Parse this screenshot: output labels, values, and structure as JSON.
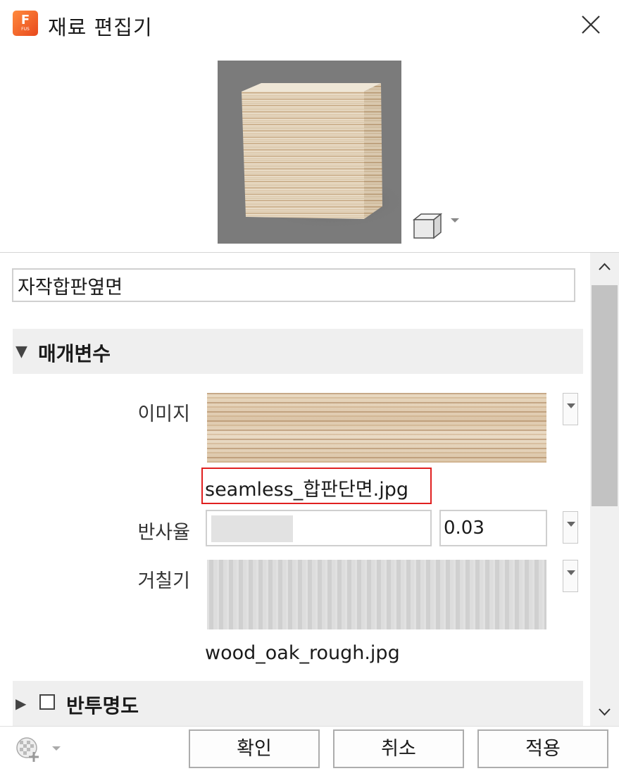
{
  "window": {
    "title": "재료 편집기",
    "app_icon_letter": "F",
    "app_icon_sub": "FUS"
  },
  "material": {
    "name": "자작합판옆면"
  },
  "sections": {
    "parameters": {
      "label": "매개변수"
    },
    "transparency": {
      "label": "반투명도",
      "checked": false
    }
  },
  "params": {
    "image": {
      "label": "이미지",
      "filename": "seamless_합판단면.jpg"
    },
    "reflectance": {
      "label": "반사율",
      "value": "0.03",
      "level": 0.38
    },
    "roughness": {
      "label": "거칠기",
      "filename": "wood_oak_rough.jpg"
    }
  },
  "buttons": {
    "ok": "확인",
    "cancel": "취소",
    "apply": "적용"
  },
  "icons": {
    "close": "close-icon",
    "shape": "cube-shape-icon",
    "library": "material-library-add-icon",
    "scroll_up": "chevron-up-icon",
    "scroll_down": "chevron-down-icon"
  },
  "colors": {
    "highlight": "#e02020",
    "section_bg": "#efefef",
    "preview_bg": "#7b7b7b"
  }
}
